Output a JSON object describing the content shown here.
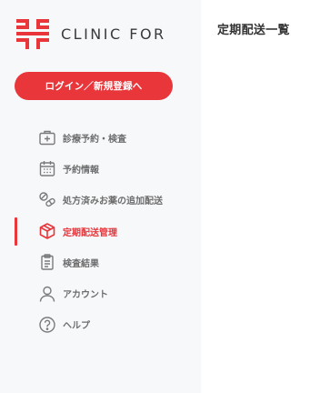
{
  "brand": {
    "name": "CLINIC FOR",
    "accent": "#e8363b"
  },
  "login_button": {
    "label": "ログイン／新規登録へ"
  },
  "nav": {
    "items": [
      {
        "label": "診療予約・検査",
        "icon": "medical-bag-icon",
        "active": false
      },
      {
        "label": "予約情報",
        "icon": "calendar-icon",
        "active": false
      },
      {
        "label": "処方済みお薬の追加配送",
        "icon": "pills-icon",
        "active": false
      },
      {
        "label": "定期配送管理",
        "icon": "package-box-icon",
        "active": true
      },
      {
        "label": "検査結果",
        "icon": "clipboard-document-icon",
        "active": false
      },
      {
        "label": "アカウント",
        "icon": "user-icon",
        "active": false
      },
      {
        "label": "ヘルプ",
        "icon": "help-question-icon",
        "active": false
      }
    ]
  },
  "main": {
    "title": "定期配送一覧"
  }
}
